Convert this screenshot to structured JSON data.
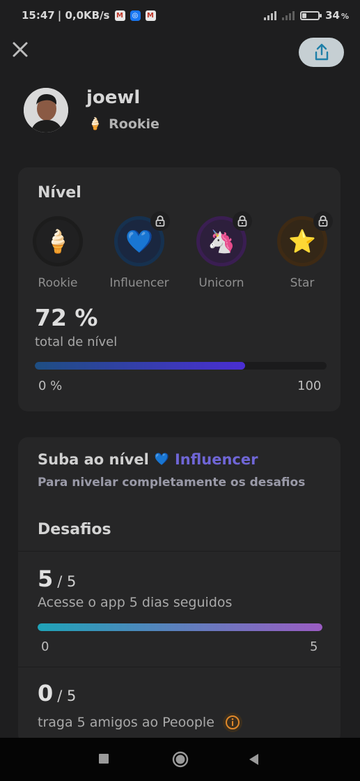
{
  "status_bar": {
    "time": "15:47",
    "net_speed": "| 0,0KB/s",
    "battery": "34",
    "battery_unit": "%",
    "battery_level": 0.34,
    "notification_icons": [
      "gmail-icon",
      "messenger-icon",
      "gmail-icon"
    ]
  },
  "header": {
    "close_icon": "close-icon",
    "share_icon": "share-icon"
  },
  "profile": {
    "username": "joewl",
    "rank_emoji": "🍦",
    "rank": "Rookie"
  },
  "level_card": {
    "title": "Nível",
    "badges": [
      {
        "emoji": "🍦",
        "label": "Rookie",
        "locked": false
      },
      {
        "emoji": "💙",
        "label": "Influencer",
        "locked": true
      },
      {
        "emoji": "🦄",
        "label": "Unicorn",
        "locked": true
      },
      {
        "emoji": "⭐",
        "label": "Star",
        "locked": true
      }
    ],
    "percent_text": "72 %",
    "percent_label": "total de nível",
    "progress": 0.72,
    "min_label": "0 %",
    "max_label": "100"
  },
  "next_level_card": {
    "title_prefix": "Suba ao nível",
    "target_emoji": "💙",
    "target_name": "Influencer",
    "subtitle": "Para nivelar completamente os desafios",
    "challenges_title": "Desafios",
    "challenges": [
      {
        "count": "5",
        "total": "/ 5",
        "description": "Acesse o app 5 dias seguidos",
        "progress": 1.0,
        "min_label": "0",
        "max_label": "5"
      },
      {
        "count": "0",
        "total": "/ 5",
        "description": "traga 5 amigos ao Peoople",
        "info_icon": "info-icon"
      }
    ]
  },
  "nav_bar": {
    "buttons": [
      "recent-apps-icon",
      "home-icon",
      "back-icon"
    ]
  },
  "colors": {
    "accent": "#6f66d6",
    "level_bar_start": "#1e4e82",
    "level_bar_end": "#4a2ed3",
    "challenge_bar_start": "#1fa3b8",
    "challenge_bar_end": "#9a5cc2"
  }
}
